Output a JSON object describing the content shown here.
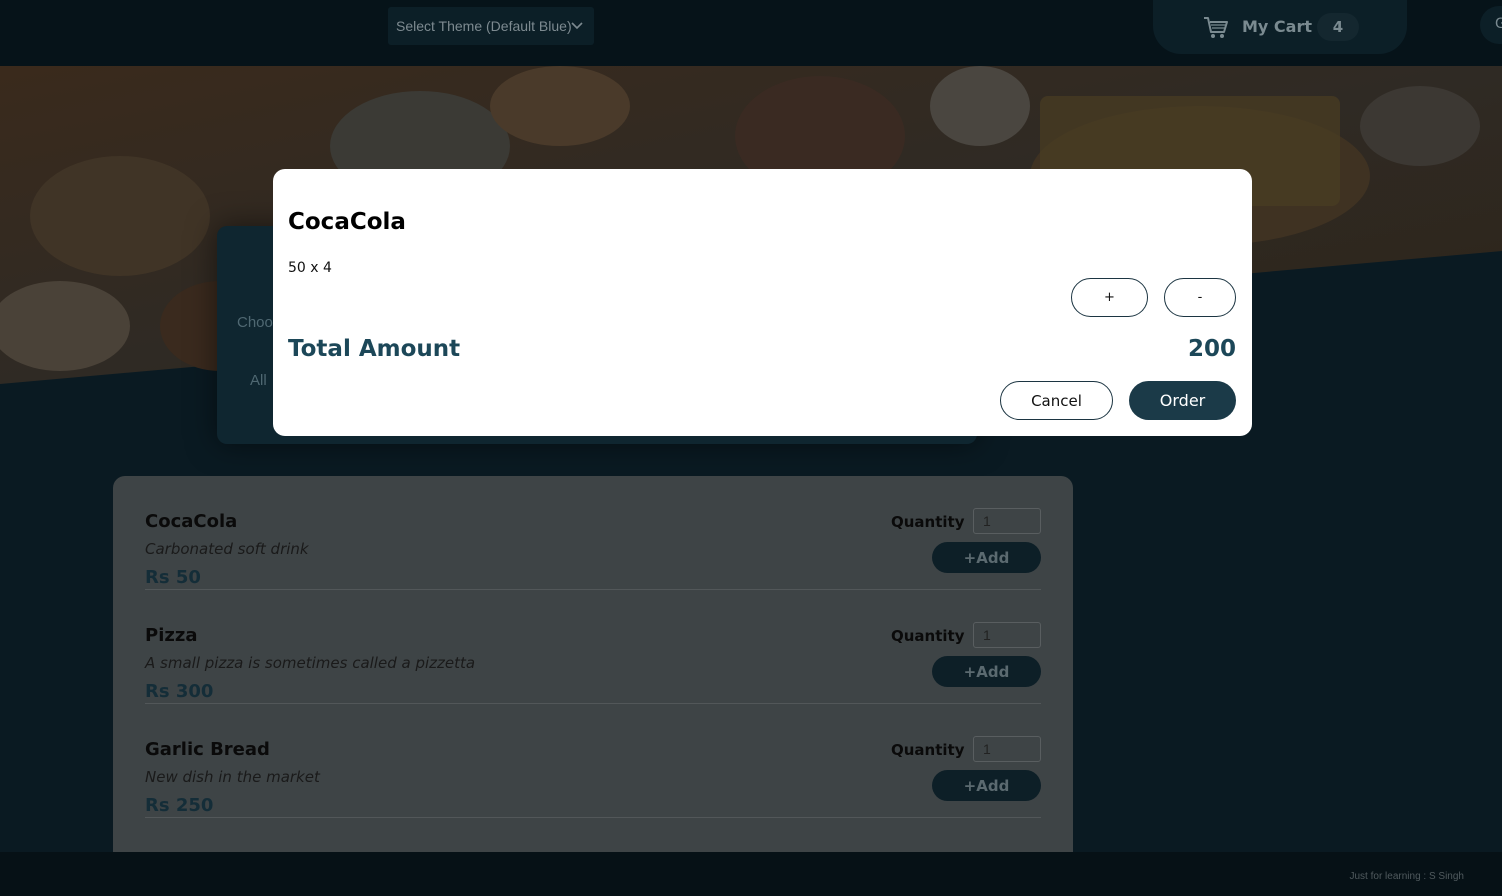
{
  "header": {
    "theme_select": "Select Theme (Default Blue)",
    "cart_label": "My Cart",
    "cart_count": "4",
    "login_partial": "G"
  },
  "filter": {
    "title_partial": "Choo",
    "chip_partial": "All"
  },
  "menu": {
    "items": [
      {
        "name": "CocaCola",
        "description": "Carbonated soft drink",
        "price": "Rs 50",
        "qty_label": "Quantity",
        "qty_value": "1",
        "add_label": "+Add"
      },
      {
        "name": "Pizza",
        "description": "A small pizza is sometimes called a pizzetta",
        "price": "Rs 300",
        "qty_label": "Quantity",
        "qty_value": "1",
        "add_label": "+Add"
      },
      {
        "name": "Garlic Bread",
        "description": "New dish in the market",
        "price": "Rs 250",
        "qty_label": "Quantity",
        "qty_value": "1",
        "add_label": "+Add"
      }
    ]
  },
  "modal": {
    "title": "CocaCola",
    "line": "50 x 4",
    "plus_label": "+",
    "minus_label": "-",
    "total_label": "Total Amount",
    "total_value": "200",
    "cancel_label": "Cancel",
    "order_label": "Order"
  },
  "footer": {
    "credit": "Just for learning : S Singh"
  },
  "colors": {
    "page_bg": "#0a1a22",
    "header_bg": "#061319",
    "accent_dark": "#1b3a48",
    "total_text": "#1c4758"
  }
}
